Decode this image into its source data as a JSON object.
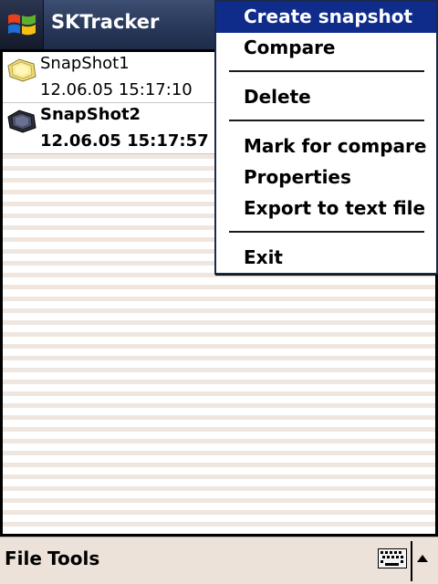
{
  "app": {
    "title": "SKTracker"
  },
  "titlebar": {
    "start_icon": "windows-logo-icon"
  },
  "snapshots": [
    {
      "name": "SnapShot1",
      "date": "12.06.05 15:17:10",
      "icon": "snapshot-icon",
      "bold": false
    },
    {
      "name": "SnapShot2",
      "date": "12.06.05 15:17:57",
      "icon": "snapshot-marked-icon",
      "bold": true
    }
  ],
  "menu": {
    "items": [
      {
        "label": "Create snapshot",
        "selected": true
      },
      {
        "label": "Compare"
      },
      {
        "label": "Delete"
      },
      {
        "label": "Mark for compare"
      },
      {
        "label": "Properties"
      },
      {
        "label": "Export to text file"
      },
      {
        "label": "Exit"
      }
    ]
  },
  "menubar": {
    "file_label": "File",
    "tools_label": "Tools",
    "keyboard_icon": "keyboard-icon",
    "sip_icon": "up-arrow-icon"
  },
  "colors": {
    "titlebar": "#2a3a5c",
    "menu_highlight": "#0f2c8a",
    "menubar": "#ece2d9",
    "stripe": "#efe6df"
  }
}
